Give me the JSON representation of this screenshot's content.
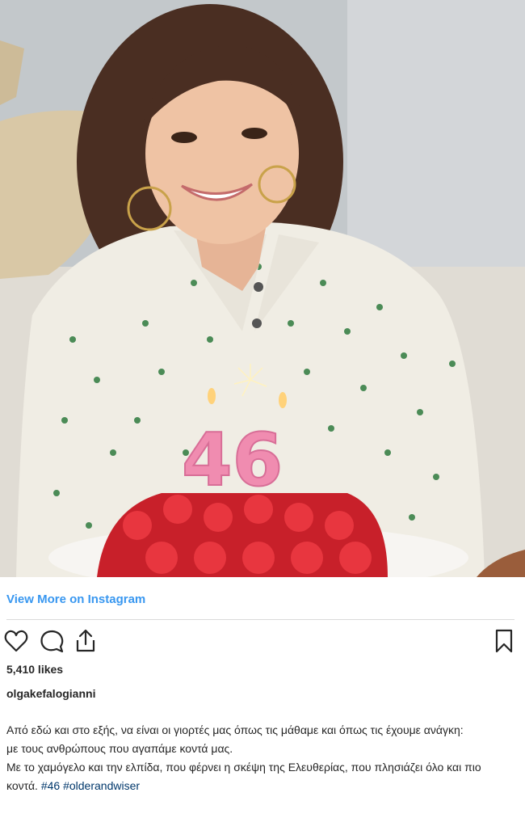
{
  "link": {
    "view_more": "View More on Instagram"
  },
  "post": {
    "likes": "5,410 likes",
    "username": "olgakefalogianni",
    "caption_lines": [
      "Από εδώ και στο εξής, να είναι οι γιορτές μας όπως τις μάθαμε και όπως τις έχουμε ανάγκη:",
      "με τους ανθρώπους που αγαπάμε κοντά μας.",
      "Με το χαμόγελο και την ελπίδα, που φέρνει η σκέψη της Ελευθερίας, που πλησιάζει όλο και πιο κοντά."
    ],
    "hashtags": [
      "#46",
      "#olderandwiser"
    ],
    "candles": "46"
  },
  "colors": {
    "link_blue": "#3897f0",
    "hashtag_blue": "#00376b",
    "text": "#262626",
    "divider": "#dbdbdb"
  },
  "icons": [
    "heart-icon",
    "comment-icon",
    "share-icon",
    "bookmark-icon"
  ]
}
